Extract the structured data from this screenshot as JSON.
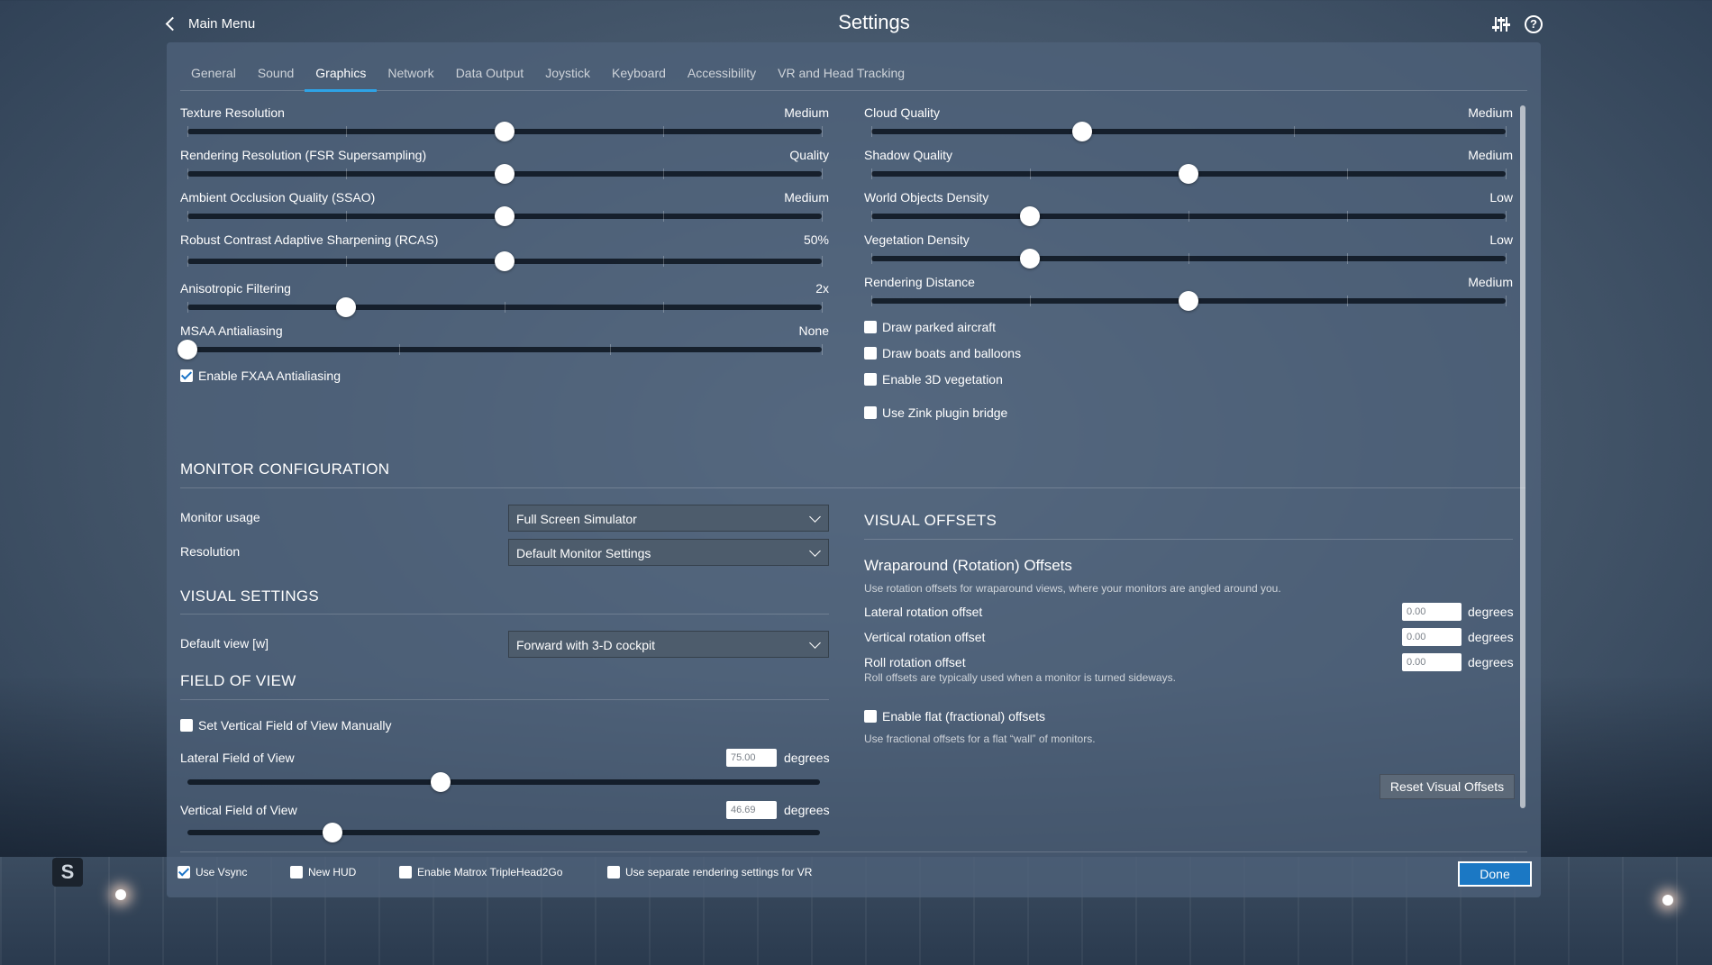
{
  "header": {
    "back_label": "Main Menu",
    "title": "Settings"
  },
  "tabs": [
    {
      "label": "General"
    },
    {
      "label": "Sound"
    },
    {
      "label": "Graphics"
    },
    {
      "label": "Network"
    },
    {
      "label": "Data Output"
    },
    {
      "label": "Joystick"
    },
    {
      "label": "Keyboard"
    },
    {
      "label": "Accessibility"
    },
    {
      "label": "VR and Head Tracking"
    }
  ],
  "active_tab": "Graphics",
  "graphics_left": {
    "sliders": [
      {
        "label": "Texture Resolution",
        "value": "Medium",
        "fraction": 0.5
      },
      {
        "label": "Rendering Resolution (FSR Supersampling)",
        "value": "Quality",
        "fraction": 0.5
      },
      {
        "label": "Ambient Occlusion Quality (SSAO)",
        "value": "Medium",
        "fraction": 0.5
      },
      {
        "label": "Robust Contrast Adaptive Sharpening (RCAS)",
        "value": "50%",
        "fraction": 0.5
      },
      {
        "label": "Anisotropic Filtering",
        "value": "2x",
        "fraction": 0.25
      },
      {
        "label": "MSAA Antialiasing",
        "value": "None",
        "fraction": 0.0
      }
    ],
    "fxaa_label": "Enable FXAA Antialiasing",
    "fxaa_checked": true
  },
  "graphics_right": {
    "sliders": [
      {
        "label": "Cloud Quality",
        "value": "Medium",
        "fraction": 0.333
      },
      {
        "label": "Shadow Quality",
        "value": "Medium",
        "fraction": 0.5
      },
      {
        "label": "World Objects Density",
        "value": "Low",
        "fraction": 0.25
      },
      {
        "label": "Vegetation Density",
        "value": "Low",
        "fraction": 0.25
      },
      {
        "label": "Rendering Distance",
        "value": "Medium",
        "fraction": 0.5
      }
    ],
    "checkboxes": [
      {
        "label": "Draw parked aircraft",
        "checked": false
      },
      {
        "label": "Draw boats and balloons",
        "checked": false
      },
      {
        "label": "Enable 3D vegetation",
        "checked": false
      },
      {
        "label": "Use Zink plugin bridge",
        "checked": false
      }
    ]
  },
  "monitor": {
    "title": "MONITOR CONFIGURATION",
    "usage_label": "Monitor usage",
    "usage_value": "Full Screen Simulator",
    "resolution_label": "Resolution",
    "resolution_value": "Default Monitor Settings"
  },
  "visual_settings": {
    "title": "VISUAL SETTINGS",
    "default_view_label": "Default view [w]",
    "default_view_value": "Forward with 3-D cockpit"
  },
  "fov": {
    "title": "FIELD OF VIEW",
    "manual_label": "Set Vertical Field of View Manually",
    "manual_checked": false,
    "lateral_label": "Lateral Field of View",
    "lateral_value": "75.00",
    "lateral_unit": "degrees",
    "lateral_fraction": 0.4,
    "vertical_label": "Vertical Field of View",
    "vertical_value": "46.69",
    "vertical_unit": "degrees",
    "vertical_fraction": 0.23
  },
  "visual_offsets": {
    "title": "VISUAL OFFSETS",
    "wrap_title": "Wraparound (Rotation) Offsets",
    "wrap_note": "Use rotation offsets for wraparound views, where your monitors are angled around you.",
    "offsets": [
      {
        "label": "Lateral rotation offset",
        "value": "0.00",
        "unit": "degrees"
      },
      {
        "label": "Vertical rotation offset",
        "value": "0.00",
        "unit": "degrees"
      },
      {
        "label": "Roll rotation offset",
        "value": "0.00",
        "unit": "degrees"
      }
    ],
    "roll_note": "Roll offsets are typically used when a monitor is turned sideways.",
    "flat_label": "Enable flat (fractional) offsets",
    "flat_checked": false,
    "flat_note": "Use fractional offsets for a flat “wall” of monitors.",
    "reset_label": "Reset Visual Offsets"
  },
  "footer": {
    "checks": [
      {
        "label": "Use Vsync",
        "checked": true
      },
      {
        "label": "New HUD",
        "checked": false
      },
      {
        "label": "Enable Matrox TripleHead2Go",
        "checked": false
      },
      {
        "label": "Use separate rendering settings for VR",
        "checked": false
      }
    ],
    "done_label": "Done"
  },
  "colors": {
    "accent": "#2ea3e6",
    "done_button": "#1b78c4"
  }
}
